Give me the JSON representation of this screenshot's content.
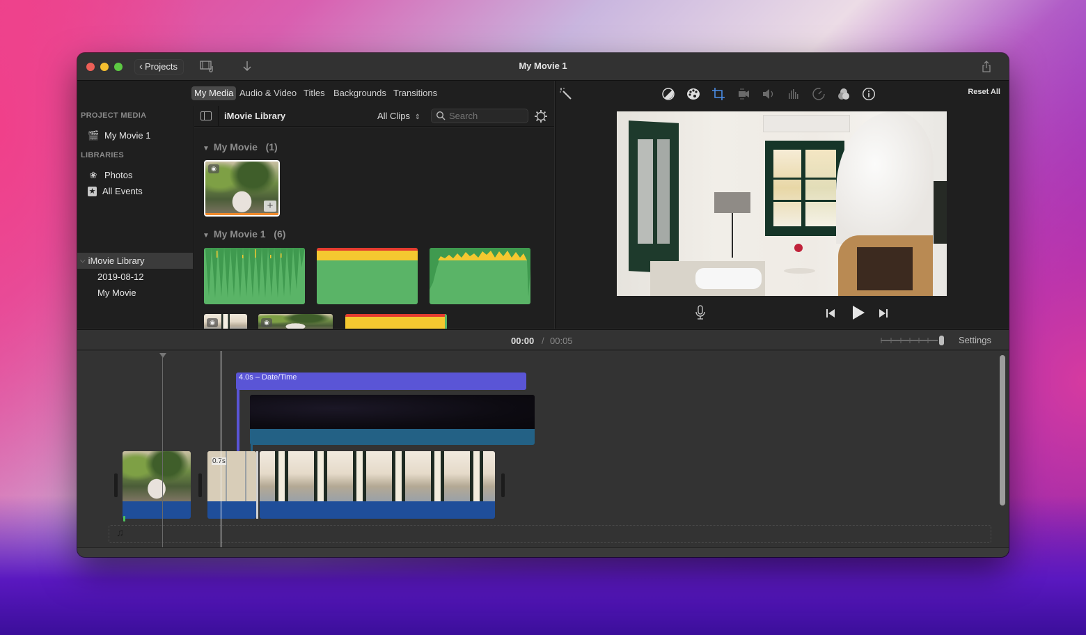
{
  "window": {
    "title": "My Movie 1",
    "projects_label": "Projects",
    "icons": [
      "media-import-icon",
      "download-arrow-icon",
      "share-icon"
    ]
  },
  "browser": {
    "tabs": [
      {
        "label": "My Media",
        "active": true
      },
      {
        "label": "Audio & Video",
        "active": false
      },
      {
        "label": "Titles",
        "active": false
      },
      {
        "label": "Backgrounds",
        "active": false
      },
      {
        "label": "Transitions",
        "active": false
      }
    ],
    "library_name": "iMovie Library",
    "filter": "All Clips",
    "search_placeholder": "Search"
  },
  "sidebar": {
    "project_media_heading": "PROJECT MEDIA",
    "project_item": "My Movie 1",
    "libraries_heading": "LIBRARIES",
    "items": [
      {
        "label": "Photos",
        "icon": "photos-icon"
      },
      {
        "label": "All Events",
        "icon": "star-icon"
      }
    ],
    "library": {
      "label": "iMovie Library",
      "selected": true
    },
    "events": [
      "2019-08-12",
      "My Movie"
    ]
  },
  "media_sections": [
    {
      "title": "My Movie",
      "count": "(1)"
    },
    {
      "title": "My Movie 1",
      "count": "(6)"
    }
  ],
  "viewer": {
    "reset_all": "Reset All",
    "tools": [
      "magic-wand",
      "color-balance",
      "color-correction",
      "crop",
      "stabilization",
      "volume",
      "noise-reduction",
      "speed",
      "clip-filter",
      "info"
    ],
    "active_tool": "crop"
  },
  "timeline": {
    "current_time": "00:00",
    "separator": "/",
    "total_time": "00:05",
    "settings_label": "Settings",
    "title_clip_label": "4.0s – Date/Time",
    "transition_duration": "0.7s",
    "zoom_level": 1.0
  },
  "colors": {
    "title_clip": "#5a55d6",
    "background_clip_audio": "#236185",
    "clip_audio": "#1f4e9a",
    "audio_waveform_green": "#5ab467",
    "audio_waveform_yellow": "#f4c830",
    "audio_waveform_red": "#e43b2f",
    "crop_tool_active": "#4b8fe8"
  }
}
